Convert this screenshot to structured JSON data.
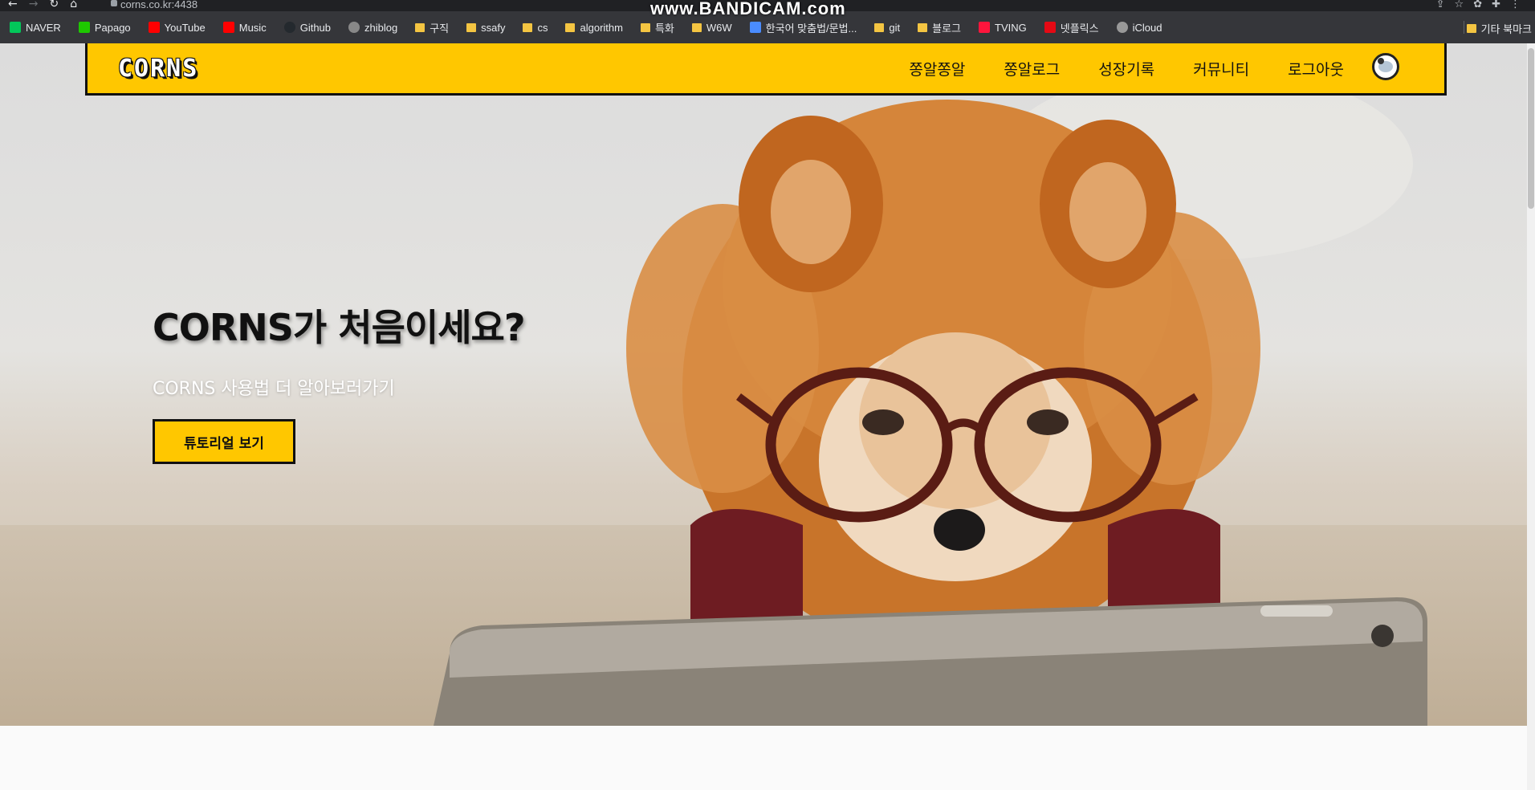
{
  "browser": {
    "url": "corns.co.kr:4438",
    "recorder_watermark": "www.BANDICAM.com",
    "bookmarks": [
      {
        "label": "NAVER",
        "icon": "naver-icon",
        "color": "#03c75a"
      },
      {
        "label": "Papago",
        "icon": "papago-icon",
        "color": "#1ec800"
      },
      {
        "label": "YouTube",
        "icon": "youtube-icon",
        "color": "#ff0000"
      },
      {
        "label": "Music",
        "icon": "youtube-music-icon",
        "color": "#ff0000"
      },
      {
        "label": "Github",
        "icon": "github-icon",
        "color": "#24292e"
      },
      {
        "label": "zhiblog",
        "icon": "zhiblog-icon",
        "color": "#888888"
      },
      {
        "label": "구직",
        "icon": "folder-icon",
        "color": "#f4c542"
      },
      {
        "label": "ssafy",
        "icon": "folder-icon",
        "color": "#f4c542"
      },
      {
        "label": "cs",
        "icon": "folder-icon",
        "color": "#f4c542"
      },
      {
        "label": "algorithm",
        "icon": "folder-icon",
        "color": "#f4c542"
      },
      {
        "label": "특화",
        "icon": "folder-icon",
        "color": "#f4c542"
      },
      {
        "label": "W6W",
        "icon": "folder-icon",
        "color": "#f4c542"
      },
      {
        "label": "한국어 맞춤법/문법...",
        "icon": "spellcheck-icon",
        "color": "#4a8cff"
      },
      {
        "label": "git",
        "icon": "folder-icon",
        "color": "#f4c542"
      },
      {
        "label": "블로그",
        "icon": "folder-icon",
        "color": "#f4c542"
      },
      {
        "label": "TVING",
        "icon": "tving-icon",
        "color": "#ff153c"
      },
      {
        "label": "넷플릭스",
        "icon": "netflix-icon",
        "color": "#e50914"
      },
      {
        "label": "iCloud",
        "icon": "apple-icon",
        "color": "#999999"
      }
    ],
    "other_bookmarks": "기타 북마크"
  },
  "header": {
    "logo": "CORNS",
    "menu": [
      "쫑알쫑알",
      "쫑알로그",
      "성장기록",
      "커뮤니티",
      "로그아웃"
    ]
  },
  "hero": {
    "title": "CORNS가 처음이세요?",
    "subtitle": "CORNS 사용법 더 알아보러가기",
    "button": "튜토리얼 보기"
  },
  "colors": {
    "brand_yellow": "#ffc700",
    "text_dark": "#111111"
  }
}
